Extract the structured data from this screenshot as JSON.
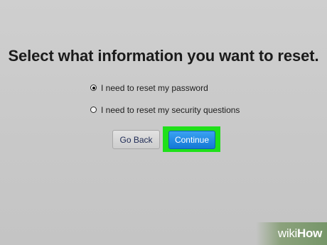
{
  "dialog": {
    "title": "Select what information you want to reset.",
    "options": [
      {
        "label": "I need to reset my password",
        "selected": true
      },
      {
        "label": "I need to reset my security questions",
        "selected": false
      }
    ],
    "buttons": {
      "back_label": "Go Back",
      "continue_label": "Continue"
    },
    "highlight_color": "#1fe01a",
    "continue_color": "#1a86e0"
  },
  "watermark": {
    "prefix": "wiki",
    "suffix": "How"
  }
}
